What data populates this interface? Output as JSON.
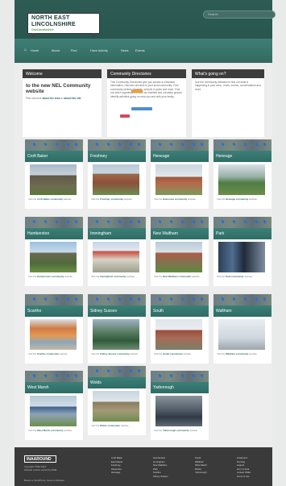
{
  "header": {
    "logo_line1": "NORTH EAST",
    "logo_line2": "LINCOLNSHIRE",
    "logo_tag": "OneLincolnshire",
    "search_placeholder": "Search"
  },
  "nav": {
    "items": [
      "Home",
      "About",
      "Find",
      "Have Activity",
      "News",
      "Events"
    ]
  },
  "cards": {
    "welcome": {
      "title": "Welcome",
      "headline": "to the new NEL Community website",
      "body_prefix": "Find out more ",
      "about_area": "about the area",
      "or": " or ",
      "about_site": "about this site"
    },
    "directories": {
      "title": "Community Directories",
      "body": "This Community Directories give you access to essential information. Discover services in your local community. Find community centres, libraries, schools & parks and more. Find out which organisations such as charities and voluntary groups. Identify activities going on near you and with your family."
    },
    "whats_on": {
      "title": "What's going on?",
      "body": "Use the community websites to find out what is happening in your area - news, events, conversations and more."
    }
  },
  "tiles": [
    {
      "name": "Croft Baker",
      "text_prefix": "Visit the ",
      "link": "Croft Baker community",
      "text_suffix": " website"
    },
    {
      "name": "Freshney",
      "text_prefix": "Visit the ",
      "link": "Freshney community",
      "text_suffix": " website"
    },
    {
      "name": "Heneage",
      "text_prefix": "Visit the ",
      "link": "Haverstoe community",
      "text_suffix": " website"
    },
    {
      "name": "Heneage",
      "text_prefix": "Visit the ",
      "link": "Heneage community",
      "text_suffix": " website"
    },
    {
      "name": "Humberston",
      "text_prefix": "Visit the ",
      "link": "Humberston community",
      "text_suffix": " website"
    },
    {
      "name": "Immingham",
      "text_prefix": "Visit the ",
      "link": "Immingham community",
      "text_suffix": " website"
    },
    {
      "name": "New Waltham",
      "text_prefix": "Visit the ",
      "link": "New Waltham community",
      "text_suffix": " website"
    },
    {
      "name": "Park",
      "text_prefix": "Visit the ",
      "link": "Park community",
      "text_suffix": " website"
    },
    {
      "name": "Scartho",
      "text_prefix": "Visit the ",
      "link": "Scartho community",
      "text_suffix": " website"
    },
    {
      "name": "Sidney Sussex",
      "text_prefix": "Visit the ",
      "link": "Sidney Sussex community",
      "text_suffix": " website"
    },
    {
      "name": "South",
      "text_prefix": "Visit the ",
      "link": "South community",
      "text_suffix": " website"
    },
    {
      "name": "Waltham",
      "text_prefix": "Visit the ",
      "link": "Waltham community",
      "text_suffix": " website"
    },
    {
      "name": "West Marsh",
      "text_prefix": "Visit the ",
      "link": "West Marsh community",
      "text_suffix": " website"
    },
    {
      "name": "Wolds",
      "text_prefix": "Visit the ",
      "link": "Wolds community",
      "text_suffix": " website"
    },
    {
      "name": "Yarborough",
      "text_prefix": "Visit the ",
      "link": "Yarborough community",
      "text_suffix": " website"
    }
  ],
  "footer": {
    "logo": "INAAROUND",
    "copyright": "Copyright ©NEL 2015",
    "copyright2": "Website content owned by NNEL",
    "powered": "Based on WordPress, theme is Modules",
    "col1": [
      "Croft Baker",
      "East Marsh",
      "Freshney",
      "Haverstoe",
      "Heneage"
    ],
    "col2": [
      "Humberston",
      "Immingham",
      "New Waltham",
      "Park",
      "Scartho",
      "Sidney Sussex"
    ],
    "col3": [
      "South",
      "Waltham",
      "West Marsh",
      "Wolds",
      "Yarborough"
    ],
    "col4": [
      "inAaround",
      "the blog",
      "support",
      "act in a beta",
      "contact NNEL",
      "terms of use"
    ]
  }
}
